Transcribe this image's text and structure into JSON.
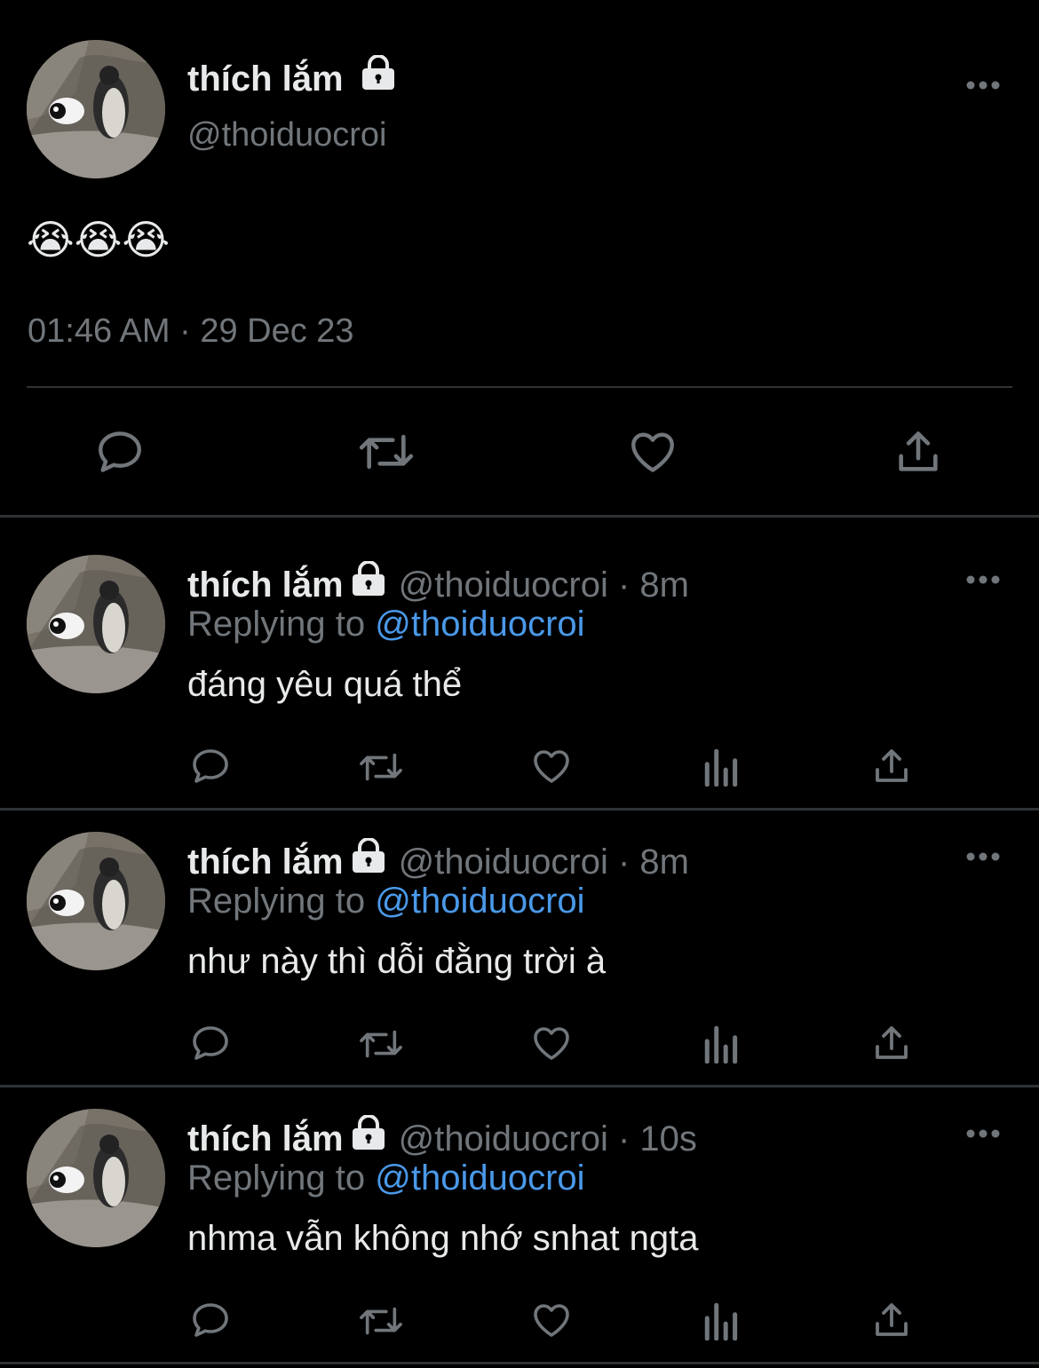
{
  "main_tweet": {
    "display_name": "thích lắm",
    "handle": "@thoiduocroi",
    "text": "😭😭😭",
    "timestamp": "01:46 AM · 29 Dec 23",
    "icons": [
      "reply-icon",
      "retweet-icon",
      "like-icon",
      "share-icon"
    ]
  },
  "replies": [
    {
      "display_name": "thích lắm",
      "meta": "@thoiduocroi · 8m",
      "replying_prefix": "Replying to ",
      "replying_to": "@thoiduocroi",
      "text": "đáng yêu quá thể"
    },
    {
      "display_name": "thích lắm",
      "meta": "@thoiduocroi · 8m",
      "replying_prefix": "Replying to ",
      "replying_to": "@thoiduocroi",
      "text": "như này thì dỗi đằng trời à"
    },
    {
      "display_name": "thích lắm",
      "meta": "@thoiduocroi · 10s",
      "replying_prefix": "Replying to ",
      "replying_to": "@thoiduocroi",
      "text": "nhma vẫn không nhớ snhat ngta"
    }
  ],
  "colors": {
    "background": "#000000",
    "text": "#e7e9ea",
    "muted": "#71767b",
    "link": "#4a99e9",
    "divider": "#2f3336"
  }
}
